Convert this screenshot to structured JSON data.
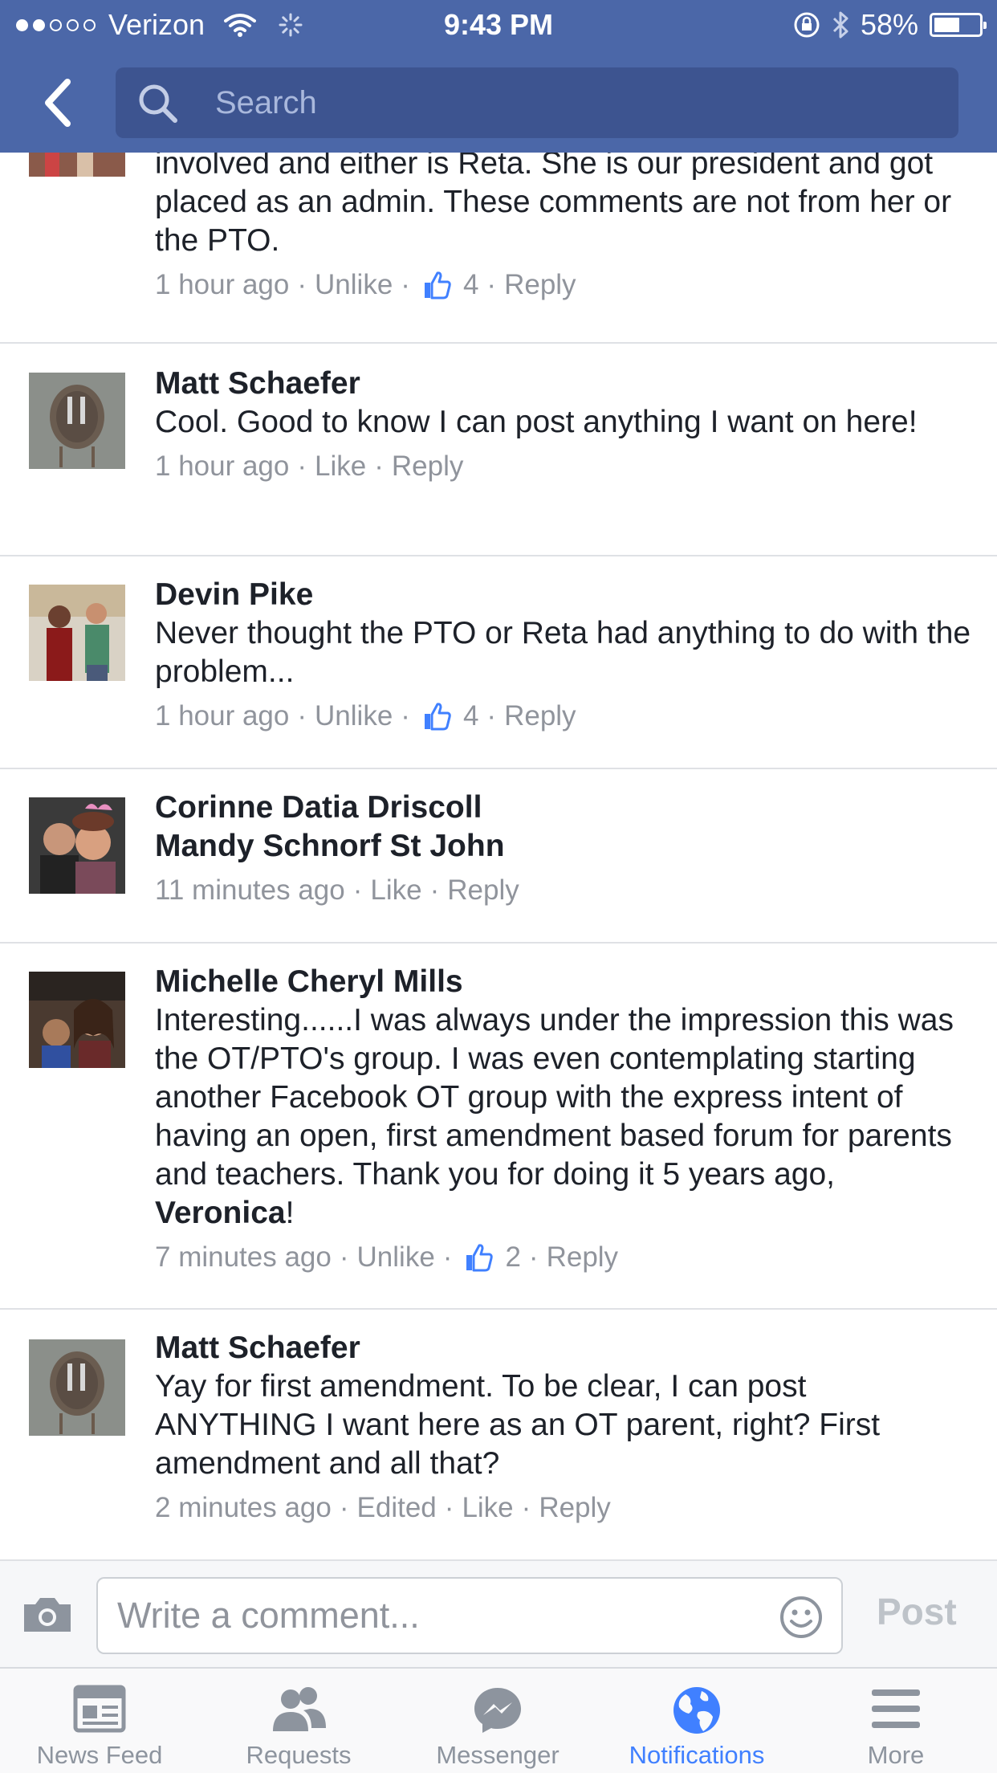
{
  "status_bar": {
    "carrier": "Verizon",
    "time": "9:43 PM",
    "battery": "58%",
    "battery_level": 0.58,
    "signal_bars_filled": 2,
    "signal_bars_total": 5
  },
  "nav": {
    "search_placeholder": "Search"
  },
  "comments": [
    {
      "author": "",
      "text": "involved and either is Reta. She is our president and got placed as an admin. These comments are not from her or the PTO.",
      "time": "1 hour ago",
      "edited": "",
      "action": "Unlike",
      "likes": "4",
      "reply": "Reply"
    },
    {
      "author": "Matt Schaefer",
      "text": "Cool.  Good to know I can post anything I want on here!",
      "time": "1 hour ago",
      "edited": "",
      "action": "Like",
      "likes": "",
      "reply": "Reply"
    },
    {
      "author": "Devin Pike",
      "text": "Never thought the PTO or Reta had anything to do with the problem...",
      "time": "1 hour ago",
      "edited": "",
      "action": "Unlike",
      "likes": "4",
      "reply": "Reply"
    },
    {
      "author": "Corinne Datia Driscoll",
      "tagged": "Mandy Schnorf St John",
      "text": "",
      "time": "11 minutes ago",
      "edited": "",
      "action": "Like",
      "likes": "",
      "reply": "Reply"
    },
    {
      "author": "Michelle Cheryl Mills",
      "text": "Interesting......I was always under the impression this was the OT/PTO's group. I was even contemplating starting another Facebook OT group with the express intent of having an open, first amendment based forum for parents and teachers. Thank you for doing it 5 years ago, ",
      "mention": "Veronica",
      "text_end": "!",
      "time": "7 minutes ago",
      "edited": "",
      "action": "Unlike",
      "likes": "2",
      "reply": "Reply"
    },
    {
      "author": "Matt Schaefer",
      "text": "Yay for first amendment. To be clear, I can post ANYTHING I want here as an OT parent, right?  First amendment and all that?",
      "time": "2 minutes ago",
      "edited": "Edited",
      "action": "Like",
      "likes": "",
      "reply": "Reply"
    }
  ],
  "composer": {
    "placeholder": "Write a comment...",
    "post_label": "Post"
  },
  "tabs": [
    {
      "label": "News Feed",
      "icon": "news-feed-icon",
      "active": false
    },
    {
      "label": "Requests",
      "icon": "friend-requests-icon",
      "active": false
    },
    {
      "label": "Messenger",
      "icon": "messenger-icon",
      "active": false
    },
    {
      "label": "Notifications",
      "icon": "globe-icon",
      "active": true
    },
    {
      "label": "More",
      "icon": "menu-icon",
      "active": false
    }
  ],
  "colors": {
    "brand_blue": "#4b67a8",
    "search_bg": "#3d5490",
    "link_gray": "#90949c",
    "active_tab": "#4080ff",
    "like_blue": "#4080ff"
  }
}
